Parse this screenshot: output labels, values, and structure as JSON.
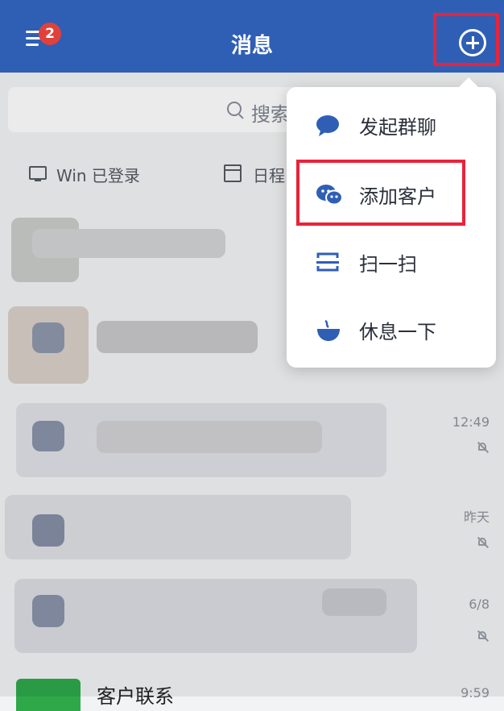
{
  "header": {
    "title": "消息",
    "badge": "2",
    "bg_color": "#2f5fb5",
    "badge_color": "#e0413a"
  },
  "search": {
    "placeholder": "搜索"
  },
  "quick": {
    "win_login": "Win 已登录",
    "schedule": "日程"
  },
  "messages": [
    {
      "time": ""
    },
    {
      "time": ""
    },
    {
      "time": "12:49",
      "muted": true
    },
    {
      "time": "昨天",
      "muted": true
    },
    {
      "time": "6/8",
      "muted": true
    },
    {
      "name": "客户联系",
      "time": "9:59"
    }
  ],
  "popup_menu": {
    "items": [
      {
        "label": "发起群聊",
        "icon": "chat-bubble-icon"
      },
      {
        "label": "添加客户",
        "icon": "wechat-icon",
        "highlighted": true
      },
      {
        "label": "扫一扫",
        "icon": "scan-icon"
      },
      {
        "label": "休息一下",
        "icon": "coffee-cup-icon"
      }
    ],
    "icon_color": "#2f5fb5"
  },
  "highlight_color": "#e8233a"
}
